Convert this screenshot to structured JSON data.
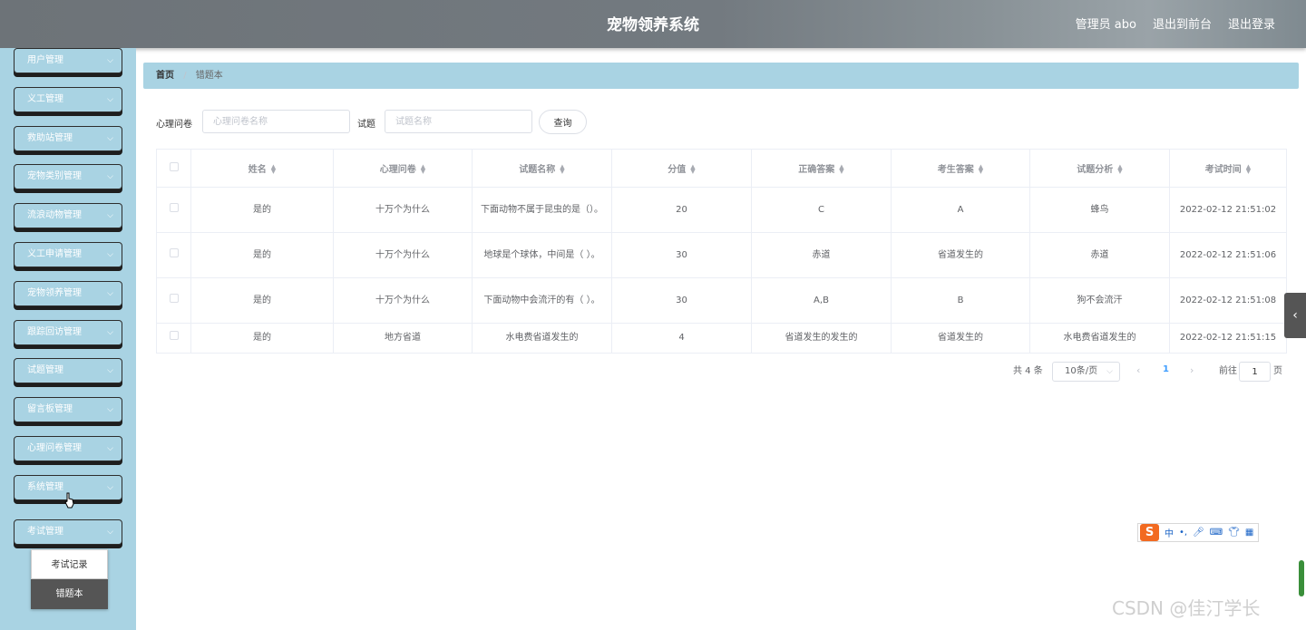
{
  "header": {
    "title": "宠物领养系统",
    "user": "管理员 abo",
    "to_front": "退出到前台",
    "logout": "退出登录"
  },
  "sidebar": {
    "items": [
      {
        "label": "用户管理"
      },
      {
        "label": "义工管理"
      },
      {
        "label": "救助站管理"
      },
      {
        "label": "宠物类别管理"
      },
      {
        "label": "流浪动物管理"
      },
      {
        "label": "义工申请管理"
      },
      {
        "label": "宠物领养管理"
      },
      {
        "label": "跟踪回访管理"
      },
      {
        "label": "试题管理"
      },
      {
        "label": "留言板管理"
      },
      {
        "label": "心理问卷管理"
      },
      {
        "label": "系统管理"
      },
      {
        "label": "考试管理"
      }
    ],
    "submenu": [
      {
        "label": "考试记录"
      },
      {
        "label": "错题本"
      }
    ]
  },
  "breadcrumb": {
    "home": "首页",
    "sep": "/",
    "current": "错题本"
  },
  "search": {
    "label1": "心理问卷",
    "placeholder1": "心理问卷名称",
    "label2": "试题",
    "placeholder2": "试题名称",
    "button": "查询"
  },
  "table": {
    "headers": [
      "姓名",
      "心理问卷",
      "试题名称",
      "分值",
      "正确答案",
      "考生答案",
      "试题分析",
      "考试时间"
    ],
    "rows": [
      {
        "name": "是的",
        "survey": "十万个为什么",
        "question": "下面动物不属于昆虫的是（）。",
        "score": "20",
        "correct": "C",
        "answer": "A",
        "analysis": "蜂鸟",
        "time": "2022-02-12 21:51:02"
      },
      {
        "name": "是的",
        "survey": "十万个为什么",
        "question": "地球是个球体，中间是（ ）。",
        "score": "30",
        "correct": "赤道",
        "answer": "省道发生的",
        "analysis": "赤道",
        "time": "2022-02-12 21:51:06"
      },
      {
        "name": "是的",
        "survey": "十万个为什么",
        "question": "下面动物中会流汗的有（ ）。",
        "score": "30",
        "correct": "A,B",
        "answer": "B",
        "analysis": "狗不会流汗",
        "time": "2022-02-12 21:51:08"
      },
      {
        "name": "是的",
        "survey": "地方省道",
        "question": "水电费省道发生的",
        "score": "4",
        "correct": "省道发生的发生的",
        "answer": "省道发生的",
        "analysis": "水电费省道发生的",
        "time": "2022-02-12 21:51:15"
      }
    ]
  },
  "pagination": {
    "total": "共 4 条",
    "page_size": "10条/页",
    "current_page": "1",
    "goto_label": "前往",
    "goto_value": "1",
    "page_suffix": "页"
  },
  "ime": {
    "logo": "S",
    "lang": "中"
  },
  "watermark": "CSDN @佳汀学长"
}
